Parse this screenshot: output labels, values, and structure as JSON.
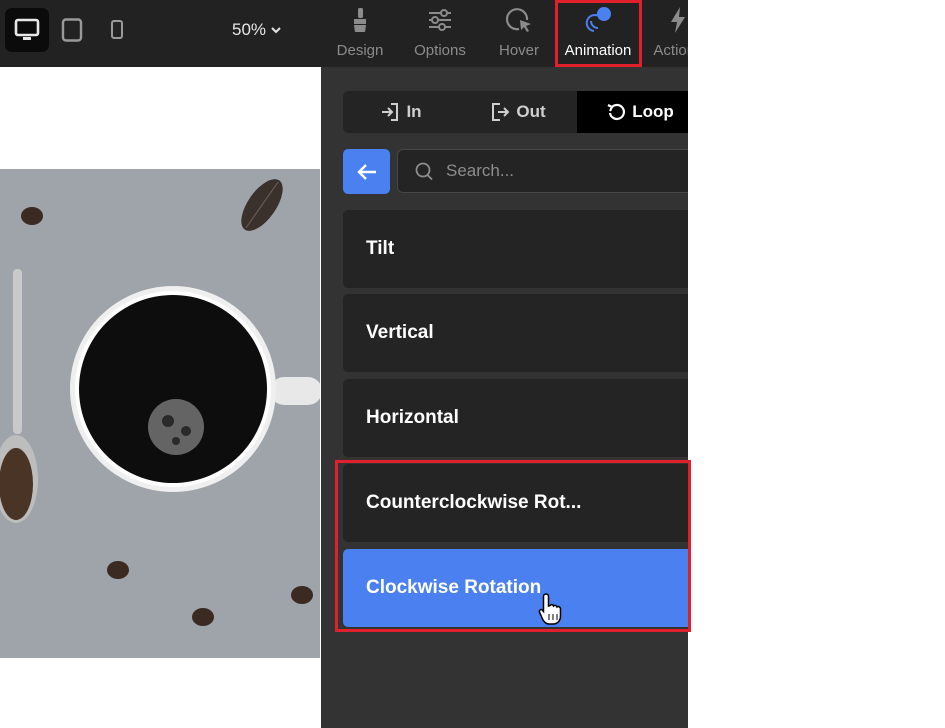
{
  "toolbar": {
    "devices": [
      {
        "icon": "desktop-icon",
        "active": true
      },
      {
        "icon": "tablet-icon",
        "active": false
      },
      {
        "icon": "mobile-icon",
        "active": false
      }
    ],
    "zoom_label": "50%",
    "tabs": [
      {
        "label": "Design",
        "icon": "brush-icon"
      },
      {
        "label": "Options",
        "icon": "sliders-icon"
      },
      {
        "label": "Hover",
        "icon": "cursor-icon"
      },
      {
        "label": "Animation",
        "icon": "animation-icon",
        "active": true
      },
      {
        "label": "Actions",
        "icon": "lightning-icon"
      }
    ]
  },
  "panel": {
    "segments": [
      {
        "label": "In",
        "icon": "enter-icon"
      },
      {
        "label": "Out",
        "icon": "exit-icon"
      },
      {
        "label": "Loop",
        "icon": "loop-icon",
        "active": true
      }
    ],
    "search": {
      "placeholder": "Search..."
    },
    "items": [
      {
        "label": "Tilt"
      },
      {
        "label": "Vertical"
      },
      {
        "label": "Horizontal"
      },
      {
        "label": "Counterclockwise Rot..."
      },
      {
        "label": "Clockwise Rotation",
        "selected": true
      }
    ]
  },
  "colors": {
    "accent": "#4a80f0",
    "highlight": "#e0202a",
    "panel_bg": "#333333",
    "item_bg": "#242424",
    "topbar_bg": "#222222"
  }
}
